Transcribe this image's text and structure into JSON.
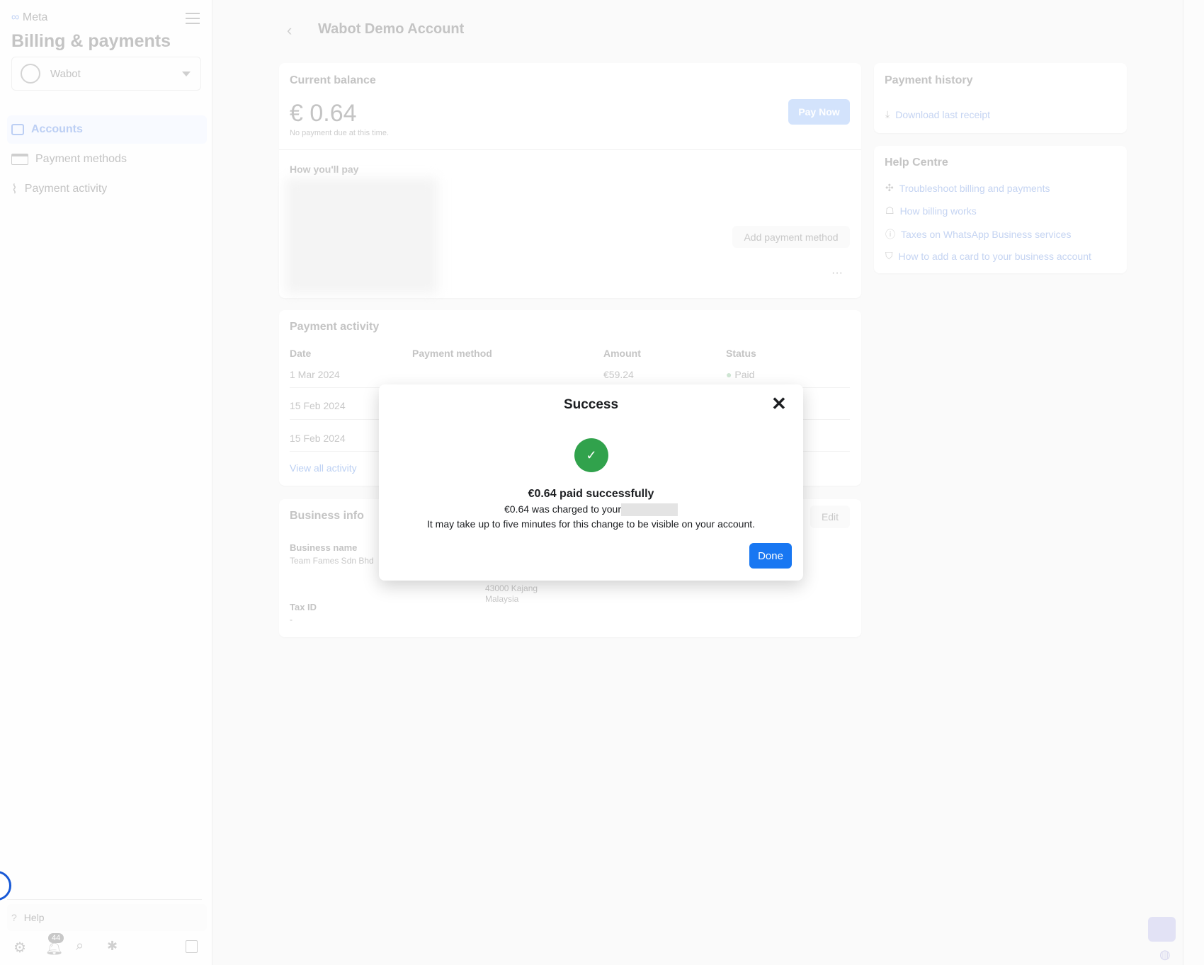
{
  "sidebar": {
    "brand": "Meta",
    "title": "Billing & payments",
    "account": "Wabot",
    "nav": [
      {
        "label": "Accounts",
        "active": true
      },
      {
        "label": "Payment methods"
      },
      {
        "label": "Payment activity"
      }
    ],
    "help": "Help",
    "notification_count": "44"
  },
  "header": {
    "title": "Wabot Demo Account"
  },
  "balance": {
    "title": "Current balance",
    "amount": "€ 0.64",
    "note": "No payment due at this time.",
    "pay_now": "Pay Now",
    "how_pay": "How you'll pay",
    "add_method": "Add payment method",
    "more": "···"
  },
  "activity": {
    "title": "Payment activity",
    "headers": [
      "Date",
      "Payment method",
      "Amount",
      "Status"
    ],
    "rows": [
      {
        "date": "1 Mar 2024",
        "amount": "€59.24",
        "status": "Paid"
      },
      {
        "date": "15 Feb 2024"
      },
      {
        "date": "15 Feb 2024"
      }
    ],
    "view_all": "View all activity"
  },
  "business": {
    "title": "Business info",
    "edit": "Edit",
    "name_label": "Business name",
    "name": "Team Fames Sdn Bhd",
    "address_line1": "43000 Kajang",
    "address_line2": "Malaysia",
    "tax_label": "Tax ID",
    "tax": "-"
  },
  "history": {
    "title": "Payment history",
    "download": "Download last receipt"
  },
  "help_centre": {
    "title": "Help Centre",
    "links": [
      "Troubleshoot billing and payments",
      "How billing works",
      "Taxes on WhatsApp Business services",
      "How to add a card to your business account"
    ]
  },
  "modal": {
    "title": "Success",
    "headline": "€0.64 paid successfully",
    "charged": "€0.64 was charged to your",
    "note": "It may take up to five minutes for this change to be visible on your account.",
    "done": "Done",
    "success_color": "#31a24c",
    "accent": "#1877f2"
  }
}
